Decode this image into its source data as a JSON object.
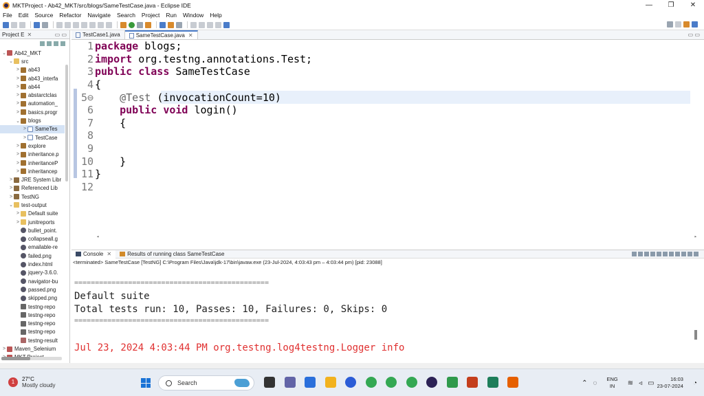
{
  "window": {
    "title": "MKTProject - Ab42_MKT/src/blogs/SameTestCase.java - Eclipse IDE",
    "controls": [
      "—",
      "❐",
      "✕"
    ]
  },
  "menu": [
    "File",
    "Edit",
    "Source",
    "Refactor",
    "Navigate",
    "Search",
    "Project",
    "Run",
    "Window",
    "Help"
  ],
  "explorer": {
    "tab_label": "Project E",
    "tree": [
      {
        "label": "Ab42_MKT",
        "depth": 0,
        "arrow": "⌄",
        "icon": "proj"
      },
      {
        "label": "src",
        "depth": 1,
        "arrow": "⌄",
        "icon": "folder"
      },
      {
        "label": "ab43",
        "depth": 2,
        "arrow": ">",
        "icon": "pkg"
      },
      {
        "label": "ab43_interfa",
        "depth": 2,
        "arrow": ">",
        "icon": "pkg"
      },
      {
        "label": "ab44",
        "depth": 2,
        "arrow": ">",
        "icon": "pkg"
      },
      {
        "label": "abstarctclas",
        "depth": 2,
        "arrow": ">",
        "icon": "pkg"
      },
      {
        "label": "automation_",
        "depth": 2,
        "arrow": ">",
        "icon": "pkg"
      },
      {
        "label": "basics.progr",
        "depth": 2,
        "arrow": ">",
        "icon": "pkg"
      },
      {
        "label": "blogs",
        "depth": 2,
        "arrow": "⌄",
        "icon": "pkg"
      },
      {
        "label": "SameTes",
        "depth": 3,
        "arrow": ">",
        "icon": "java",
        "selected": true
      },
      {
        "label": "TestCase",
        "depth": 3,
        "arrow": ">",
        "icon": "java"
      },
      {
        "label": "explore",
        "depth": 2,
        "arrow": ">",
        "icon": "pkg"
      },
      {
        "label": "inheritance.p",
        "depth": 2,
        "arrow": ">",
        "icon": "pkg"
      },
      {
        "label": "inheritanceP",
        "depth": 2,
        "arrow": ">",
        "icon": "pkg"
      },
      {
        "label": "inheritancep",
        "depth": 2,
        "arrow": ">",
        "icon": "pkg"
      },
      {
        "label": "JRE System Libr",
        "depth": 1,
        "arrow": ">",
        "icon": "lib"
      },
      {
        "label": "Referenced Lib",
        "depth": 1,
        "arrow": ">",
        "icon": "lib"
      },
      {
        "label": "TestNG",
        "depth": 1,
        "arrow": ">",
        "icon": "lib"
      },
      {
        "label": "test-output",
        "depth": 1,
        "arrow": "⌄",
        "icon": "folder"
      },
      {
        "label": "Default suite",
        "depth": 2,
        "arrow": ">",
        "icon": "folder"
      },
      {
        "label": "junitreports",
        "depth": 2,
        "arrow": ">",
        "icon": "folder"
      },
      {
        "label": "bullet_point.",
        "depth": 2,
        "arrow": "",
        "icon": "file"
      },
      {
        "label": "collapseall.g",
        "depth": 2,
        "arrow": "",
        "icon": "file"
      },
      {
        "label": "emailable-re",
        "depth": 2,
        "arrow": "",
        "icon": "file"
      },
      {
        "label": "failed.png",
        "depth": 2,
        "arrow": "",
        "icon": "file"
      },
      {
        "label": "index.html",
        "depth": 2,
        "arrow": "",
        "icon": "file"
      },
      {
        "label": "jquery-3.6.0.",
        "depth": 2,
        "arrow": "",
        "icon": "file"
      },
      {
        "label": "navigator-bu",
        "depth": 2,
        "arrow": "",
        "icon": "file"
      },
      {
        "label": "passed.png",
        "depth": 2,
        "arrow": "",
        "icon": "file"
      },
      {
        "label": "skipped.png",
        "depth": 2,
        "arrow": "",
        "icon": "file"
      },
      {
        "label": "testng-repo",
        "depth": 2,
        "arrow": "",
        "icon": "img"
      },
      {
        "label": "testng-repo",
        "depth": 2,
        "arrow": "",
        "icon": "img"
      },
      {
        "label": "testng-repo",
        "depth": 2,
        "arrow": "",
        "icon": "img"
      },
      {
        "label": "testng-repo",
        "depth": 2,
        "arrow": "",
        "icon": "img"
      },
      {
        "label": "testng-result",
        "depth": 2,
        "arrow": "",
        "icon": "xml"
      },
      {
        "label": "Maven_Selenium",
        "depth": 0,
        "arrow": ">",
        "icon": "proj"
      },
      {
        "label": "MKT Project",
        "depth": 0,
        "arrow": ">",
        "icon": "proj"
      }
    ]
  },
  "editor": {
    "tabs": [
      {
        "label": "TestCase1.java",
        "active": false
      },
      {
        "label": "SameTestCase.java",
        "active": true
      }
    ],
    "lines": [
      {
        "n": "1",
        "parts": [
          [
            "kw",
            "package"
          ],
          [
            "",
            "blogs;"
          ]
        ]
      },
      {
        "n": "2",
        "parts": [
          [
            "kw",
            "import"
          ],
          [
            "",
            "org.testng.annotations.Test;"
          ]
        ]
      },
      {
        "n": "3",
        "parts": [
          [
            "kw",
            "public class"
          ],
          [
            "",
            "SameTestCase"
          ]
        ]
      },
      {
        "n": "4",
        "parts": [
          [
            "",
            "{"
          ]
        ]
      },
      {
        "n": "5⊖",
        "parts": [
          [
            "ann",
            "    @Test"
          ],
          [
            "",
            "(invocationCount=10)"
          ]
        ],
        "highlight": true
      },
      {
        "n": "6",
        "parts": [
          [
            "kw",
            "    public void"
          ],
          [
            "",
            "login()"
          ]
        ]
      },
      {
        "n": "7",
        "parts": [
          [
            "",
            "    {"
          ]
        ]
      },
      {
        "n": "8",
        "parts": [
          [
            "",
            ""
          ]
        ]
      },
      {
        "n": "9",
        "parts": [
          [
            "",
            ""
          ]
        ]
      },
      {
        "n": "10",
        "parts": [
          [
            "",
            "    }"
          ]
        ]
      },
      {
        "n": "11",
        "parts": [
          [
            "",
            "}"
          ]
        ]
      },
      {
        "n": "12",
        "parts": [
          [
            "",
            ""
          ]
        ]
      }
    ]
  },
  "console": {
    "tabs": [
      {
        "label": "Console",
        "active": true
      },
      {
        "label": "Results of running class SameTestCase",
        "active": false
      }
    ],
    "status": "<terminated> SameTestCase [TestNG] C:\\Program Files\\Java\\jdk-17\\bin\\javaw.exe  (23-Jul-2024, 4:03:43 pm – 4:03:44 pm) [pid: 23088]",
    "separator": "===============================================",
    "suite": "Default suite",
    "summary": "Total tests run: 10, Passes: 10, Failures: 0, Skips: 0",
    "log": "Jul 23, 2024 4:03:44 PM org.testng.log4testng.Logger info"
  },
  "taskbar": {
    "weather_temp": "27°C",
    "weather_desc": "Mostly cloudy",
    "weather_badge": "1",
    "search_label": "Search",
    "lang_1": "ENG",
    "lang_2": "IN",
    "time": "16:03",
    "date": "23-07-2024",
    "app_colors": [
      "#333",
      "#6264a7",
      "#2a6fdb",
      "#f2b21e",
      "#2b5cd6",
      "#34a853",
      "#34a853",
      "#34a853",
      "#2c2255",
      "#2f9a4c",
      "#c43e1c",
      "#1e7e5a",
      "#e66000"
    ]
  }
}
